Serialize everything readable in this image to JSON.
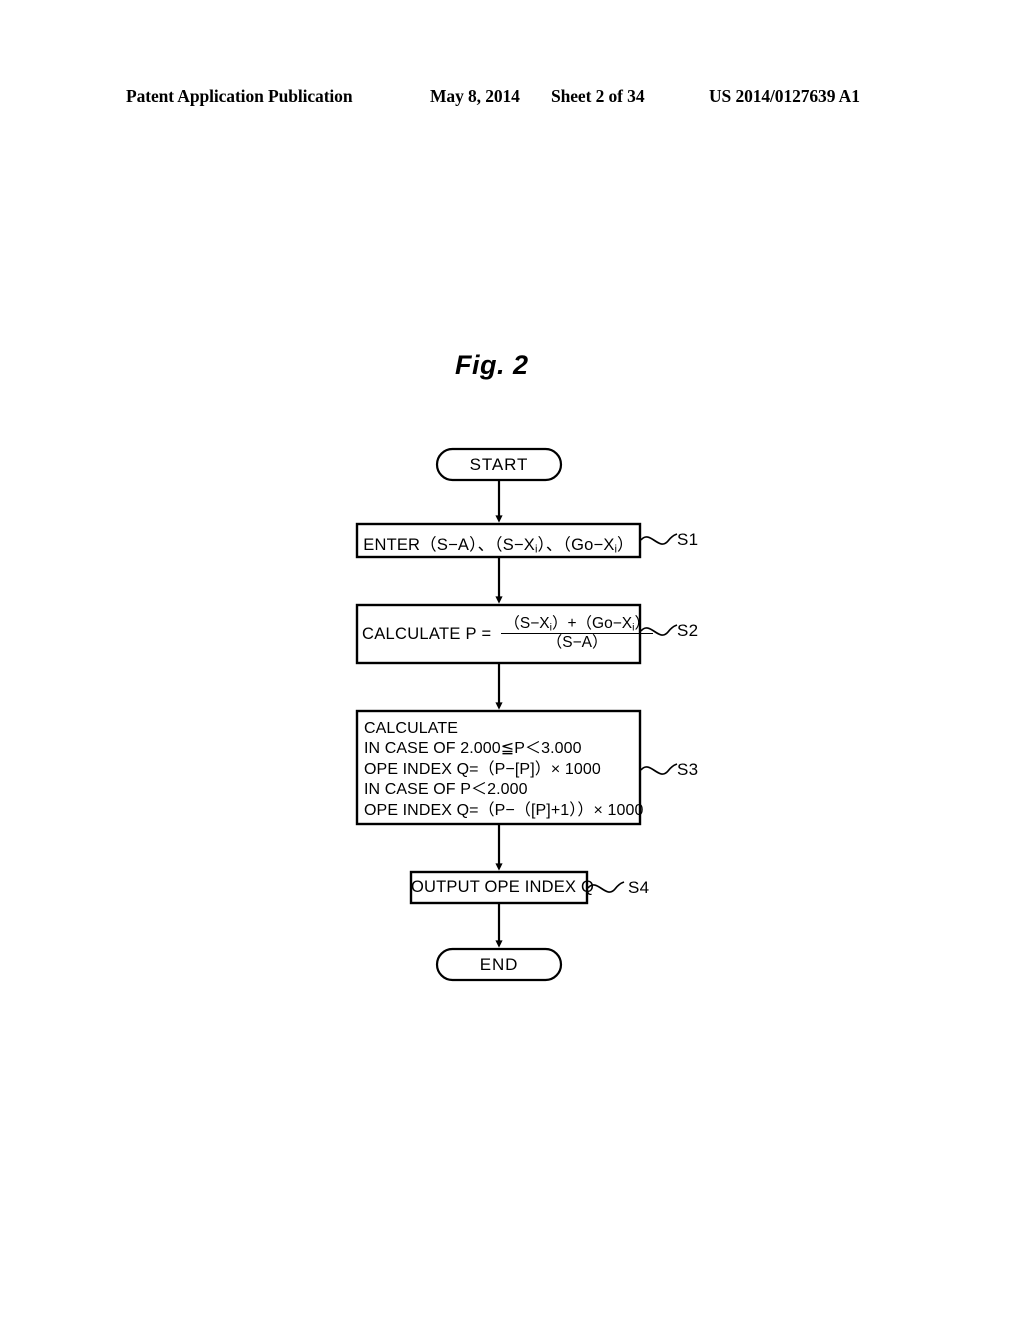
{
  "header": {
    "publication": "Patent Application Publication",
    "date": "May 8, 2014",
    "sheet": "Sheet 2 of 34",
    "patent_number": "US 2014/0127639 A1"
  },
  "figure": {
    "label": "Fig. 2"
  },
  "flowchart": {
    "start": {
      "label": "START",
      "shape": "terminator"
    },
    "end": {
      "label": "END",
      "shape": "terminator"
    },
    "steps": [
      {
        "ref": "S1",
        "shape": "process",
        "align": "center",
        "text": "ENTER（S−A）、（S−Xi）、（Go−Xi）"
      },
      {
        "ref": "S2",
        "shape": "process",
        "align": "left",
        "lhs": "CALCULATE P =",
        "numerator": "（S−Xi）+（Go−Xi）",
        "denominator": "（S−A）"
      },
      {
        "ref": "S3",
        "shape": "process",
        "align": "left",
        "lines": [
          "CALCULATE",
          "IN CASE OF 2.000≦P＜3.000",
          "OPE INDEX Q=（P−[P]）× 1000",
          "IN CASE OF P＜2.000",
          "OPE INDEX Q=（P−（[P]+1））× 1000"
        ]
      },
      {
        "ref": "S4",
        "shape": "process",
        "align": "center",
        "text": "OUTPUT OPE INDEX Q"
      }
    ],
    "step_refs": {
      "s1": "S1",
      "s2": "S2",
      "s3": "S3",
      "s4": "S4"
    },
    "colors": {
      "stroke": "#000000",
      "fill": "#ffffff",
      "page": "#ffffff"
    }
  }
}
